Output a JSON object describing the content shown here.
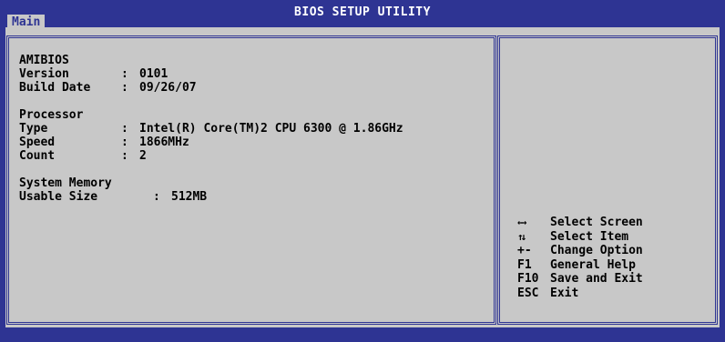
{
  "header": {
    "title": "BIOS SETUP UTILITY",
    "active_tab": "Main"
  },
  "info": {
    "amibios_heading": "AMIBIOS",
    "version_label": "Version",
    "version_value": "0101",
    "build_date_label": "Build Date",
    "build_date_value": "09/26/07",
    "processor_heading": "Processor",
    "type_label": "Type",
    "type_value": "Intel(R) Core(TM)2 CPU 6300 @ 1.86GHz",
    "speed_label": "Speed",
    "speed_value": "1866MHz",
    "count_label": "Count",
    "count_value": "2",
    "memory_heading": "System Memory",
    "usable_size_label": "Usable Size",
    "usable_size_value": "512MB",
    "separator": ":"
  },
  "help": {
    "items": [
      {
        "key": "←→",
        "key_icon": "left-right-arrows-icon",
        "label": "Select Screen"
      },
      {
        "key": "↑↓",
        "key_icon": "up-down-arrows-icon",
        "label": "Select Item"
      },
      {
        "key": "+-",
        "label": "Change Option"
      },
      {
        "key": "F1",
        "label": "General Help"
      },
      {
        "key": "F10",
        "label": "Save and Exit"
      },
      {
        "key": "ESC",
        "label": "Exit"
      }
    ]
  },
  "colors": {
    "frame_blue": "#2e3493",
    "panel_gray": "#c8c8c8",
    "title_text": "#ffffff"
  }
}
